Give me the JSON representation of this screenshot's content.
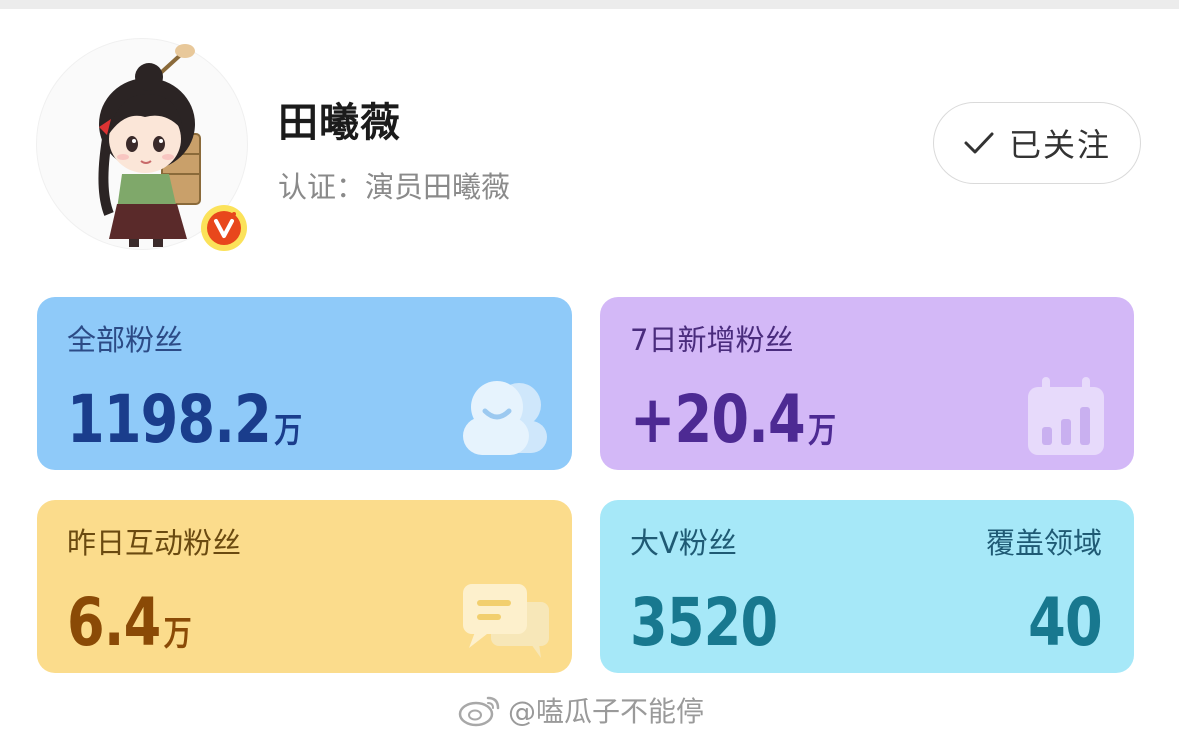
{
  "profile": {
    "name": "田曦薇",
    "verification": "认证：演员田曦薇",
    "avatar_icon": "chibi-avatar-illustration",
    "badge_icon": "verified-v-badge-icon"
  },
  "follow_button": {
    "label": "已关注",
    "icon": "checkmark-icon"
  },
  "stats": {
    "total_fans": {
      "label": "全部粉丝",
      "value": "1198.2",
      "unit": "万",
      "icon": "users-icon",
      "color": "#8fcaf9"
    },
    "new_fans_7d": {
      "label": "7日新增粉丝",
      "value": "+20.4",
      "unit": "万",
      "icon": "calendar-chart-icon",
      "color": "#d3b8f7"
    },
    "active_fans_yesterday": {
      "label": "昨日互动粉丝",
      "value": "6.4",
      "unit": "万",
      "icon": "chat-bubbles-icon",
      "color": "#fbdc8c"
    },
    "bigv_fans": {
      "label": "大V粉丝",
      "value": "3520",
      "coverage_label": "覆盖领域",
      "coverage_value": "40",
      "color": "#a6e8f8"
    }
  },
  "watermark": {
    "text": "@嗑瓜子不能停",
    "icon": "weibo-logo-icon"
  }
}
